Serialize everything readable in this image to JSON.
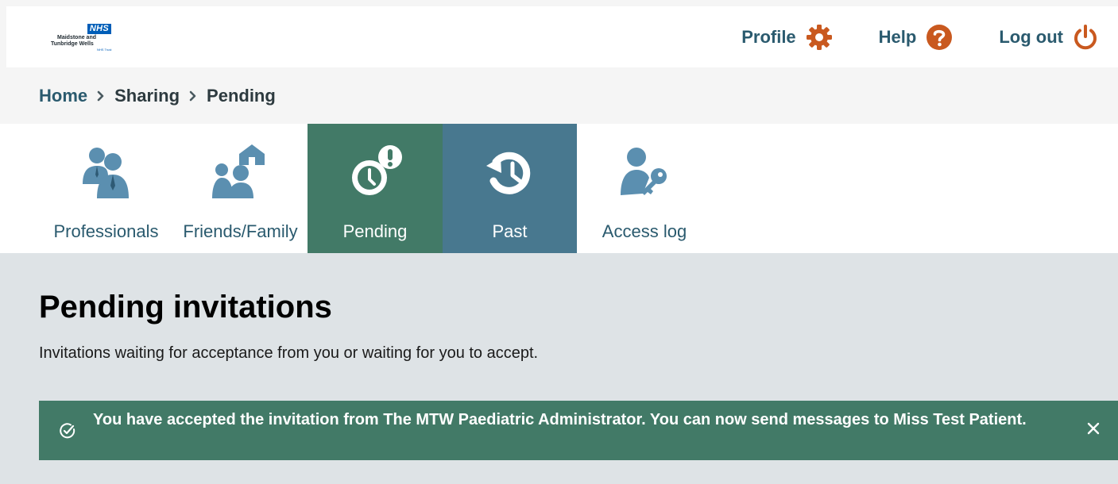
{
  "header": {
    "logo": {
      "badge": "NHS",
      "line1": "Maidstone and",
      "line2": "Tunbridge Wells",
      "line3": "NHS Trust"
    },
    "nav": [
      {
        "label": "Profile",
        "icon": "gear-icon"
      },
      {
        "label": "Help",
        "icon": "question-circle-icon"
      },
      {
        "label": "Log out",
        "icon": "power-icon"
      }
    ]
  },
  "breadcrumb": {
    "items": [
      "Home",
      "Sharing",
      "Pending"
    ]
  },
  "tabs": [
    {
      "label": "Professionals",
      "icon": "professionals-icon"
    },
    {
      "label": "Friends/Family",
      "icon": "friends-family-icon"
    },
    {
      "label": "Pending",
      "icon": "clock-alert-icon",
      "active": true
    },
    {
      "label": "Past",
      "icon": "history-icon"
    },
    {
      "label": "Access log",
      "icon": "user-key-icon"
    }
  ],
  "main": {
    "title": "Pending invitations",
    "description": "Invitations waiting for acceptance from you or waiting for you to accept."
  },
  "alert": {
    "message": "You have accepted the invitation from The MTW Paediatric Administrator. You can now send messages to Miss Test Patient."
  },
  "colors": {
    "accent_text": "#2a5a6e",
    "nav_icon": "#c9591f",
    "active_tab_green": "#427a67",
    "active_tab_blue": "#48788f",
    "tab_icon": "#5b8fb0",
    "content_bg": "#dee3e6",
    "alert_bg": "#427a67"
  }
}
